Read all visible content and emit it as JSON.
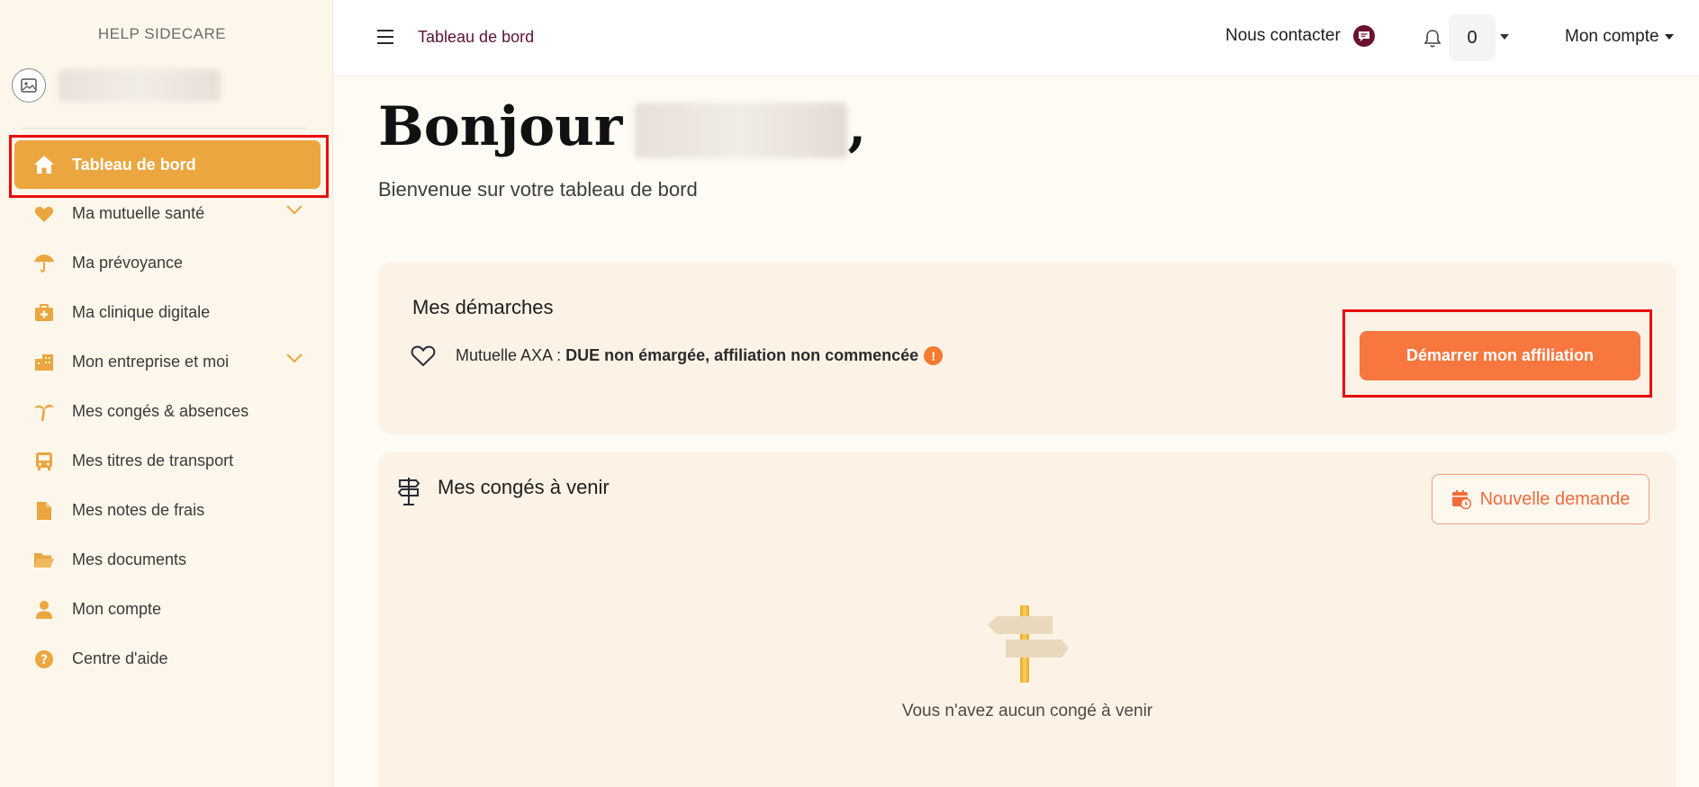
{
  "sidebar": {
    "brand": "HELP SIDECARE",
    "items": [
      {
        "label": "Tableau de bord",
        "icon": "home-icon",
        "active": true
      },
      {
        "label": "Ma mutuelle santé",
        "icon": "heart-icon",
        "expandable": true
      },
      {
        "label": "Ma prévoyance",
        "icon": "umbrella-icon"
      },
      {
        "label": "Ma clinique digitale",
        "icon": "medical-kit-icon"
      },
      {
        "label": "Mon entreprise et moi",
        "icon": "building-icon",
        "expandable": true
      },
      {
        "label": "Mes congés & absences",
        "icon": "palm-tree-icon"
      },
      {
        "label": "Mes titres de transport",
        "icon": "bus-icon"
      },
      {
        "label": "Mes notes de frais",
        "icon": "file-icon"
      },
      {
        "label": "Mes documents",
        "icon": "folder-icon"
      },
      {
        "label": "Mon compte",
        "icon": "user-icon"
      },
      {
        "label": "Centre d'aide",
        "icon": "help-icon"
      }
    ]
  },
  "topbar": {
    "breadcrumb": "Tableau de bord",
    "contact_label": "Nous contacter",
    "notification_count": "0",
    "account_label": "Mon compte"
  },
  "main": {
    "greeting": "Bonjour",
    "greeting_suffix": ",",
    "welcome": "Bienvenue sur votre tableau de bord",
    "demarches": {
      "title": "Mes démarches",
      "item_prefix": "Mutuelle AXA :",
      "item_status": "DUE non émargée, affiliation non commencée",
      "warn_symbol": "!",
      "button_label": "Démarrer mon affiliation"
    },
    "conges": {
      "title": "Mes congés à venir",
      "button_label": "Nouvelle demande",
      "empty_text": "Vous n'avez aucun congé à venir"
    }
  },
  "colors": {
    "accent": "#eba63f",
    "primary_button": "#f7773f",
    "highlight": "#e80c0c",
    "breadcrumb": "#5a1231"
  }
}
